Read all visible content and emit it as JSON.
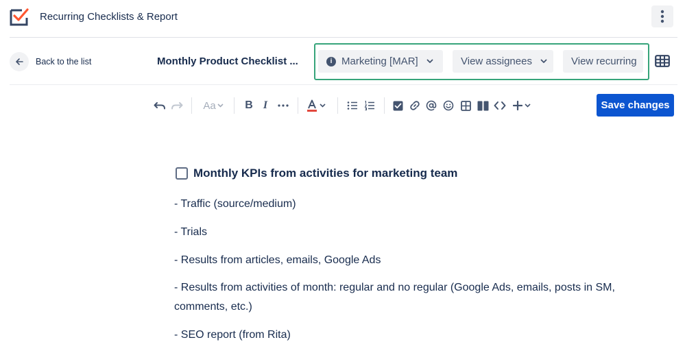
{
  "app": {
    "title": "Recurring Checklists & Report",
    "colors": {
      "logo_dark": "#344563",
      "logo_accent": "#ff5630",
      "primary": "#0c55d0",
      "highlight_border": "#36a47a"
    }
  },
  "toolbar": {
    "back_label": "Back to the list",
    "doc_title": "Monthly Product Checklist ...",
    "project_label": "Marketing [MAR]",
    "assignees_label": "View assignees",
    "recurring_label": "View recurring",
    "save_label": "Save changes"
  },
  "editor_toolbar": {
    "text_style_label": "Aa",
    "bold_label": "B",
    "italic_label": "I",
    "more_label": "···",
    "text_color_label": "A",
    "icons": [
      "undo-icon",
      "redo-icon",
      "text-style-icon",
      "bold-icon",
      "italic-icon",
      "more-formatting-icon",
      "text-color-icon",
      "bullet-list-icon",
      "numbered-list-icon",
      "action-item-icon",
      "link-icon",
      "mention-icon",
      "emoji-icon",
      "table-icon",
      "layouts-icon",
      "code-icon",
      "insert-plus-icon"
    ]
  },
  "content": {
    "task_title": "Monthly KPIs from activities for marketing team",
    "task_checked": false,
    "items": [
      "- Traffic (source/medium)",
      "- Trials",
      "- Results from articles, emails, Google Ads",
      "- Results from activities of month: regular and no regular (Google Ads, emails, posts in SM, comments, etc.)",
      "- SEO report (from Rita)"
    ]
  }
}
